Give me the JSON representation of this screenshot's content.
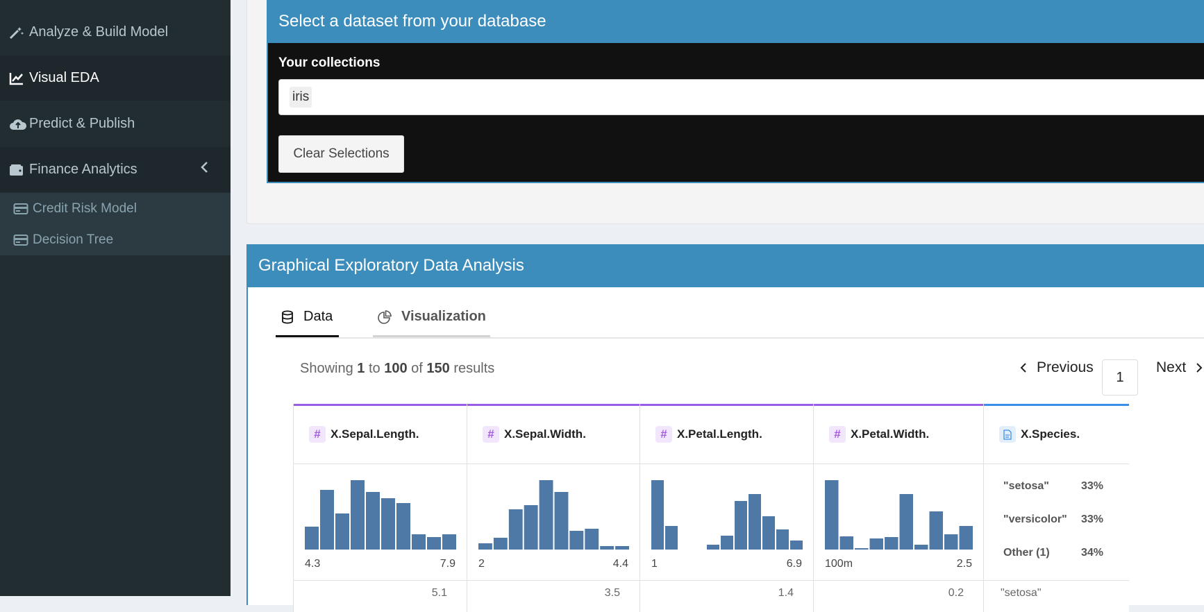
{
  "sidebar": {
    "items": [
      {
        "label": "Analyze & Build Model",
        "icon": "magic-wand-icon"
      },
      {
        "label": "Visual EDA",
        "icon": "line-chart-icon"
      },
      {
        "label": "Predict & Publish",
        "icon": "cloud-upload-icon"
      },
      {
        "label": "Finance Analytics",
        "icon": "wallet-icon"
      }
    ],
    "subitems": [
      {
        "label": "Credit Risk Model",
        "icon": "credit-card-icon"
      },
      {
        "label": "Decision Tree",
        "icon": "credit-card-icon"
      }
    ]
  },
  "dataset_box": {
    "title": "Select a dataset from your database",
    "collections_label": "Your collections",
    "selected": "iris",
    "clear_button": "Clear Selections"
  },
  "eda_box": {
    "title": "Graphical Exploratory Data Analysis",
    "tabs": [
      {
        "label": "Data",
        "icon": "database-icon"
      },
      {
        "label": "Visualization",
        "icon": "pie-chart-icon"
      }
    ],
    "summary": {
      "prefix": "Showing",
      "from": "1",
      "to_word": "to",
      "to": "100",
      "of_word": "of",
      "total": "150",
      "suffix": "results"
    },
    "pager": {
      "previous": "Previous",
      "page": "1",
      "next": "Next"
    },
    "columns": [
      {
        "name": "X.Sepal.Length.",
        "type": "numeric",
        "min": "4.3",
        "max": "7.9",
        "bins": [
          0.33,
          0.86,
          0.52,
          1.0,
          0.83,
          0.74,
          0.67,
          0.22,
          0.18,
          0.22
        ],
        "peek": "5.1"
      },
      {
        "name": "X.Sepal.Width.",
        "type": "numeric",
        "min": "2",
        "max": "4.4",
        "bins": [
          0.09,
          0.17,
          0.58,
          0.64,
          1.0,
          0.83,
          0.27,
          0.3,
          0.05,
          0.05
        ],
        "peek": "3.5"
      },
      {
        "name": "X.Petal.Length.",
        "type": "numeric",
        "min": "1",
        "max": "6.9",
        "bins": [
          1.0,
          0.34,
          0.0,
          0.0,
          0.07,
          0.2,
          0.7,
          0.8,
          0.48,
          0.29,
          0.13
        ],
        "peek": "1.4"
      },
      {
        "name": "X.Petal.Width.",
        "type": "numeric",
        "min": "100m",
        "max": "2.5",
        "bins": [
          1.0,
          0.19,
          0.02,
          0.16,
          0.18,
          0.8,
          0.07,
          0.55,
          0.22,
          0.34
        ],
        "peek": "0.2"
      },
      {
        "name": "X.Species.",
        "type": "string",
        "categories": [
          {
            "label": "\"setosa\"",
            "pct": "33%"
          },
          {
            "label": "\"versicolor\"",
            "pct": "33%"
          },
          {
            "label": "Other (1)",
            "pct": "34%"
          }
        ],
        "peek": "\"setosa\""
      }
    ]
  },
  "colors": {
    "accent": "#3c8dbc",
    "sidebar": "#222d32",
    "bar": "#4e79a7",
    "numeric_top": "#9b5de5",
    "string_top": "#3b8ee8"
  }
}
